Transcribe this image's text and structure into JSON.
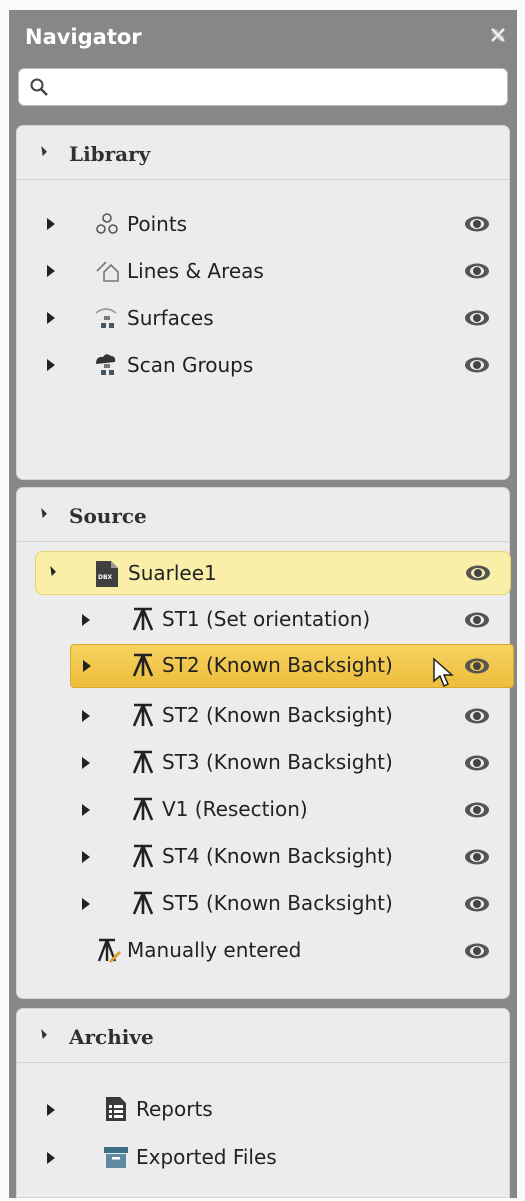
{
  "header": {
    "title": "Navigator",
    "close_icon": "close-icon"
  },
  "search": {
    "placeholder": "",
    "value": ""
  },
  "library": {
    "title": "Library",
    "items": [
      {
        "label": "Points",
        "icon": "points-icon"
      },
      {
        "label": "Lines & Areas",
        "icon": "lines-areas-icon"
      },
      {
        "label": "Surfaces",
        "icon": "surfaces-icon"
      },
      {
        "label": "Scan Groups",
        "icon": "scan-groups-icon"
      }
    ]
  },
  "source": {
    "title": "Source",
    "root": {
      "label": "Suarlee1",
      "icon": "dbx-file-icon",
      "icon_text": "DBX"
    },
    "stations": [
      {
        "label": "ST1 (Set orientation)"
      },
      {
        "label": "ST2 (Known Backsight)",
        "selected": true
      },
      {
        "label": "ST2 (Known Backsight)"
      },
      {
        "label": "ST3 (Known Backsight)"
      },
      {
        "label": "V1 (Resection)"
      },
      {
        "label": "ST4 (Known Backsight)"
      },
      {
        "label": "ST5 (Known Backsight)"
      }
    ],
    "manual": {
      "label": "Manually entered",
      "icon": "manual-station-icon"
    }
  },
  "archive": {
    "title": "Archive",
    "items": [
      {
        "label": "Reports",
        "icon": "report-icon"
      },
      {
        "label": "Exported Files",
        "icon": "exported-files-icon"
      }
    ]
  },
  "colors": {
    "panel_bg": "#878787",
    "section_bg": "#ececec",
    "highlight": "#f9efa9",
    "selected": "#f0c445"
  }
}
